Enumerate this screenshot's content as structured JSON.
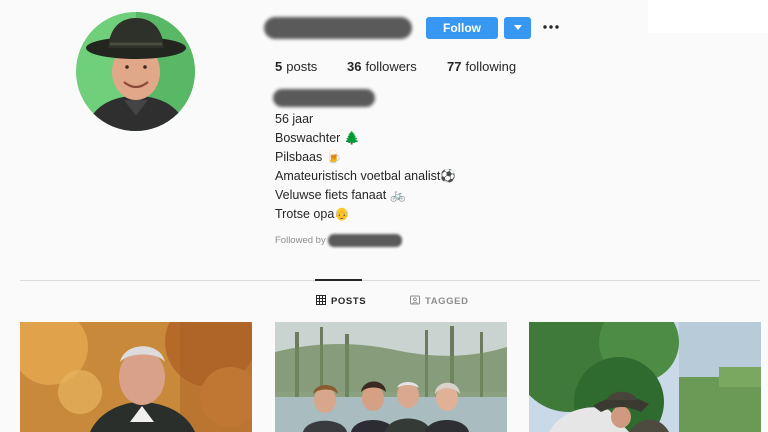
{
  "profile": {
    "follow_label": "Follow",
    "stats": {
      "posts_count": "5",
      "posts_label": "posts",
      "followers_count": "36",
      "followers_label": "followers",
      "following_count": "77",
      "following_label": "following"
    },
    "bio": [
      {
        "text": "56 jaar",
        "emoji": ""
      },
      {
        "text": "Boswachter",
        "emoji": "🌲"
      },
      {
        "text": "Pilsbaas",
        "emoji": "🍺"
      },
      {
        "text": "Amateuristisch voetbal analist",
        "emoji": "⚽"
      },
      {
        "text": "Veluwse fiets fanaat",
        "emoji": "🚲"
      },
      {
        "text": "Trotse opa",
        "emoji": "👴"
      }
    ],
    "followed_by_label": "Followed by"
  },
  "tabs": [
    {
      "label": "POSTS",
      "icon": "grid-icon",
      "active": true
    },
    {
      "label": "TAGGED",
      "icon": "tag-icon",
      "active": false
    }
  ],
  "colors": {
    "accent": "#3897f0",
    "background": "#fafafa",
    "text": "#262626",
    "muted": "#8e8e8e"
  }
}
